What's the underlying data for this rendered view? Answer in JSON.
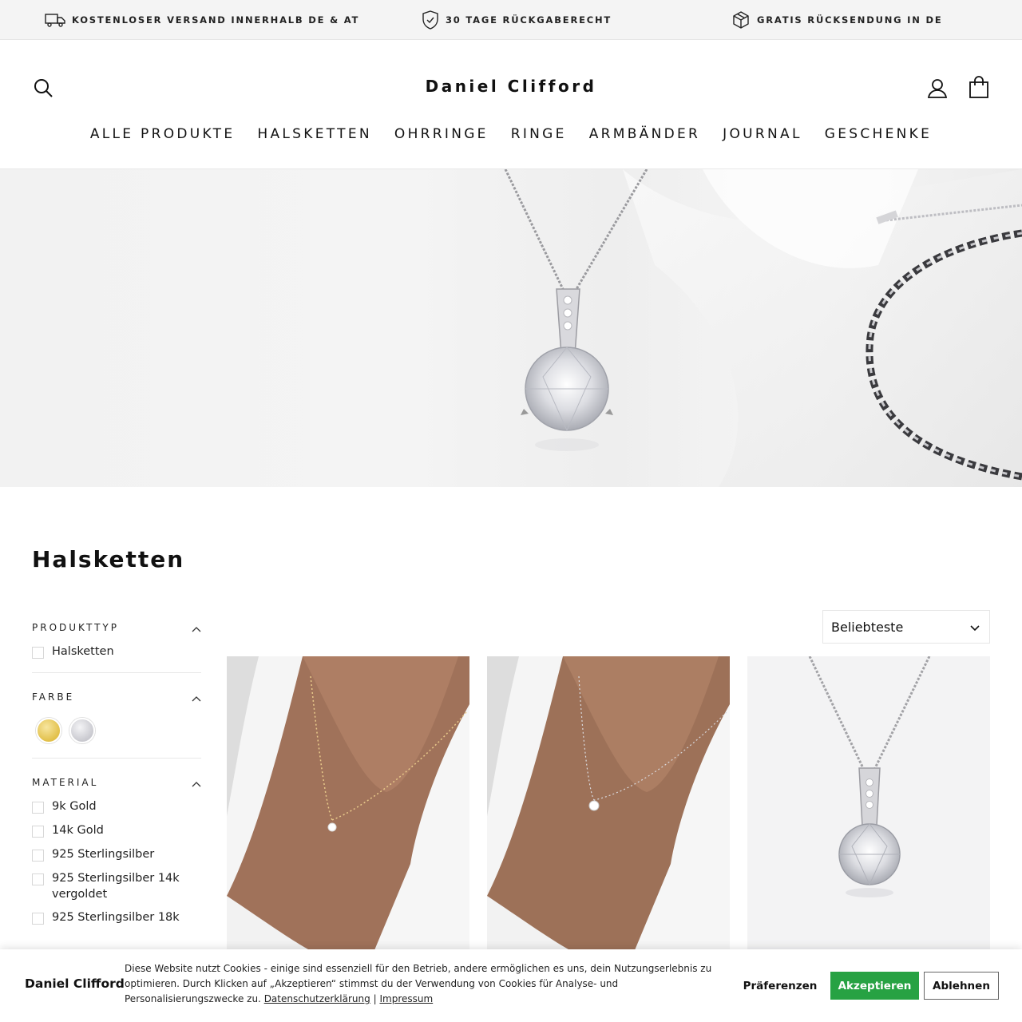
{
  "announcement": {
    "items": [
      {
        "icon": "truck-icon",
        "text": "KOSTENLOSER VERSAND INNERHALB DE & AT"
      },
      {
        "icon": "shield-check-icon",
        "text": "30 TAGE RÜCKGABERECHT"
      },
      {
        "icon": "package-icon",
        "text": "GRATIS RÜCKSENDUNG IN DE"
      }
    ]
  },
  "header": {
    "logo": "Daniel Clifford",
    "search_icon": "search-icon",
    "account_icon": "user-icon",
    "cart_icon": "shopping-bag-icon"
  },
  "nav": {
    "items": [
      "ALLE PRODUKTE",
      "HALSKETTEN",
      "OHRRINGE",
      "RINGE",
      "ARMBÄNDER",
      "JOURNAL",
      "GESCHENKE"
    ]
  },
  "collection": {
    "title": "Halsketten"
  },
  "filters": {
    "product_type": {
      "title": "PRODUKTTYP",
      "options": [
        "Halsketten"
      ]
    },
    "color": {
      "title": "FARBE",
      "swatches": [
        "#e9c84f",
        "#d9d9de"
      ]
    },
    "material": {
      "title": "MATERIAL",
      "options": [
        "9k Gold",
        "14k Gold",
        "925 Sterlingsilber",
        "925 Sterlingsilber 14k vergoldet",
        "925 Sterlingsilber 18k"
      ]
    }
  },
  "sort": {
    "selected": "Beliebteste"
  },
  "cookie": {
    "logo": "Daniel Clifford",
    "text": "Diese Website nutzt Cookies - einige sind essenziell für den Betrieb, andere ermöglichen es uns, dein Nutzungserlebnis zu optimieren. Durch Klicken auf „Akzeptieren“ stimmst du der Verwendung von Cookies für Analyse- und Personalisierungszwecke zu.",
    "privacy_link": "Datenschutzerklärung",
    "separator": "|",
    "imprint_link": "Impressum",
    "preferences": "Präferenzen",
    "accept": "Akzeptieren",
    "decline": "Ablehnen"
  },
  "colors": {
    "accept_green": "#27a243",
    "announcement_bg": "#f4f4f4"
  }
}
